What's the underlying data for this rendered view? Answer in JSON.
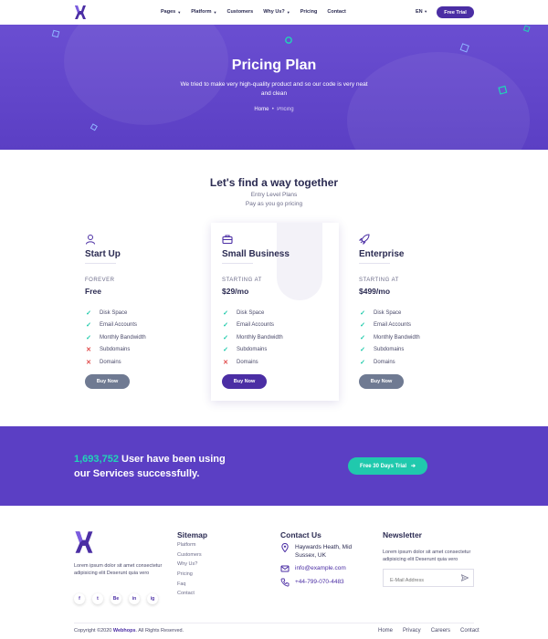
{
  "nav": {
    "items": [
      "Pages",
      "Platform",
      "Customers",
      "Why Us?",
      "Pricing",
      "Contact"
    ],
    "language": "EN",
    "cta": "Free Trial"
  },
  "hero": {
    "title": "Pricing Plan",
    "subtitle": "We tried to make very high-quality product and so our code is very neat and clean",
    "breadcrumb": [
      "Home",
      "Pricing"
    ]
  },
  "pricing": {
    "title": "Let's find a way together",
    "sub1": "Entry Level Plans",
    "sub2": "Pay as you go pricing",
    "plans": [
      {
        "icon": "user-icon",
        "name": "Start Up",
        "period": "FOREVER",
        "price": "Free",
        "features": [
          {
            "label": "Disk Space",
            "included": true
          },
          {
            "label": "Email Accounts",
            "included": true
          },
          {
            "label": "Monthly Bandwidth",
            "included": true
          },
          {
            "label": "Subdomains",
            "included": false
          },
          {
            "label": "Domains",
            "included": false
          }
        ],
        "button": "Buy Now"
      },
      {
        "icon": "briefcase-icon",
        "name": "Small Business",
        "period": "STARTING AT",
        "price": "$29/mo",
        "features": [
          {
            "label": "Disk Space",
            "included": true
          },
          {
            "label": "Email Accounts",
            "included": true
          },
          {
            "label": "Monthly Bandwidth",
            "included": true
          },
          {
            "label": "Subdomains",
            "included": true
          },
          {
            "label": "Domains",
            "included": false
          }
        ],
        "button": "Buy Now"
      },
      {
        "icon": "rocket-icon",
        "name": "Enterprise",
        "period": "STARTING AT",
        "price": "$499/mo",
        "features": [
          {
            "label": "Disk Space",
            "included": true
          },
          {
            "label": "Email Accounts",
            "included": true
          },
          {
            "label": "Monthly Bandwidth",
            "included": true
          },
          {
            "label": "Subdomains",
            "included": true
          },
          {
            "label": "Domains",
            "included": true
          }
        ],
        "button": "Buy Now"
      }
    ]
  },
  "stats": {
    "number": "1,693,752",
    "text1": "User have been using",
    "text2": "our Services successfully.",
    "button": "Free 30 Days Trial"
  },
  "footer": {
    "about": "Lorem ipsum dolor sit amet consectetur adipisicing elit Deserunt quia vero",
    "social": [
      "f",
      "t",
      "Be",
      "in",
      "ig"
    ],
    "sitemap_title": "Sitemap",
    "sitemap": [
      "Platform",
      "Customers",
      "Why Us?",
      "Pricing",
      "Faq",
      "Contact"
    ],
    "contact_title": "Contact Us",
    "address": "Haywards Heath, Mid Sussex, UK",
    "email": "info@example.com",
    "phone": "+44-799-070-4483",
    "newsletter_title": "Newsletter",
    "newsletter_text": "Lorem ipsum dolor sit amet consectetur adipisicing elit Deserunt quia vero",
    "email_placeholder": "E-Mail Address",
    "copyright_pre": "Copyright ©2020",
    "brand": "Webhops",
    "copyright_post": ". All Rights Reserved.",
    "bottom_links": [
      "Home",
      "Privacy",
      "Careers",
      "Contact"
    ]
  },
  "colors": {
    "primary": "#5b3fc4",
    "accent": "#20c9ad",
    "dark": "#2b2b52",
    "danger": "#e14b4b"
  }
}
